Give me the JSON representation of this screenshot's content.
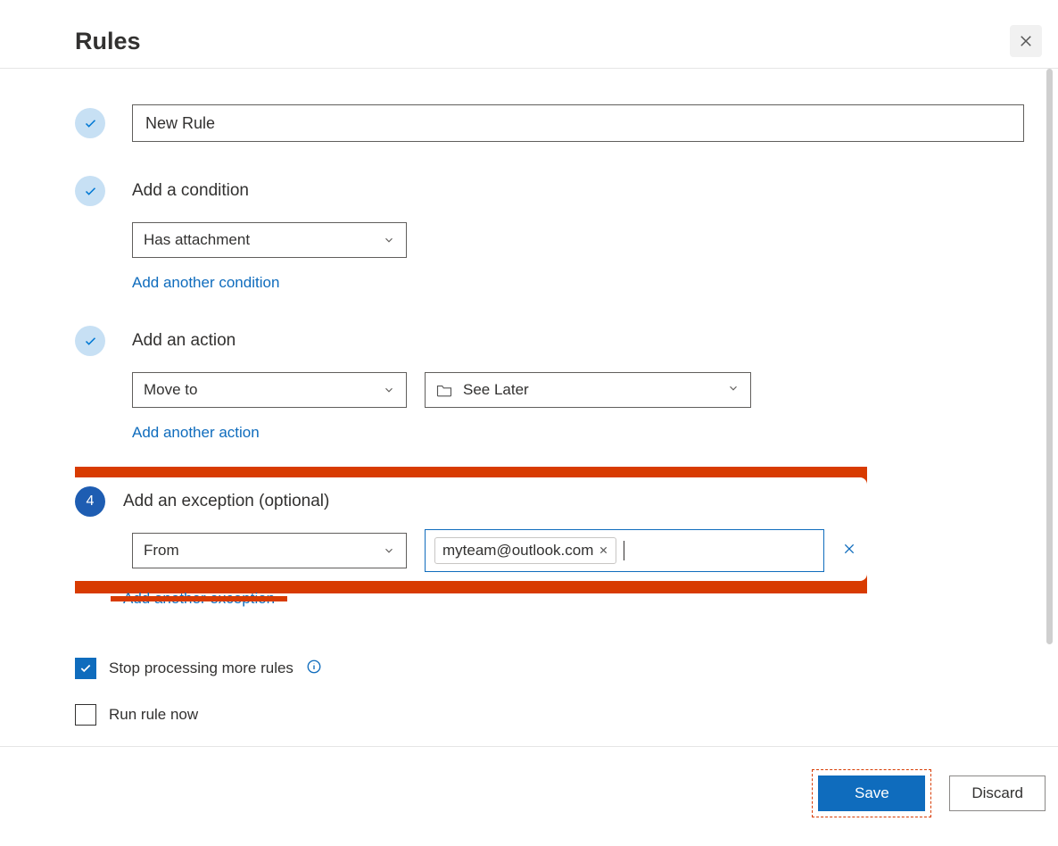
{
  "header": {
    "title": "Rules"
  },
  "rule_name": {
    "value": "New Rule"
  },
  "condition": {
    "section_label": "Add a condition",
    "selected": "Has attachment",
    "add_another": "Add another condition"
  },
  "action": {
    "section_label": "Add an action",
    "selected": "Move to",
    "folder": "See Later",
    "add_another": "Add another action"
  },
  "exception": {
    "step_number": "4",
    "section_label": "Add an exception (optional)",
    "selected": "From",
    "chip_value": "myteam@outlook.com",
    "add_another": "Add another exception"
  },
  "options": {
    "stop_processing": "Stop processing more rules",
    "run_now": "Run rule now"
  },
  "footer": {
    "save": "Save",
    "discard": "Discard"
  }
}
